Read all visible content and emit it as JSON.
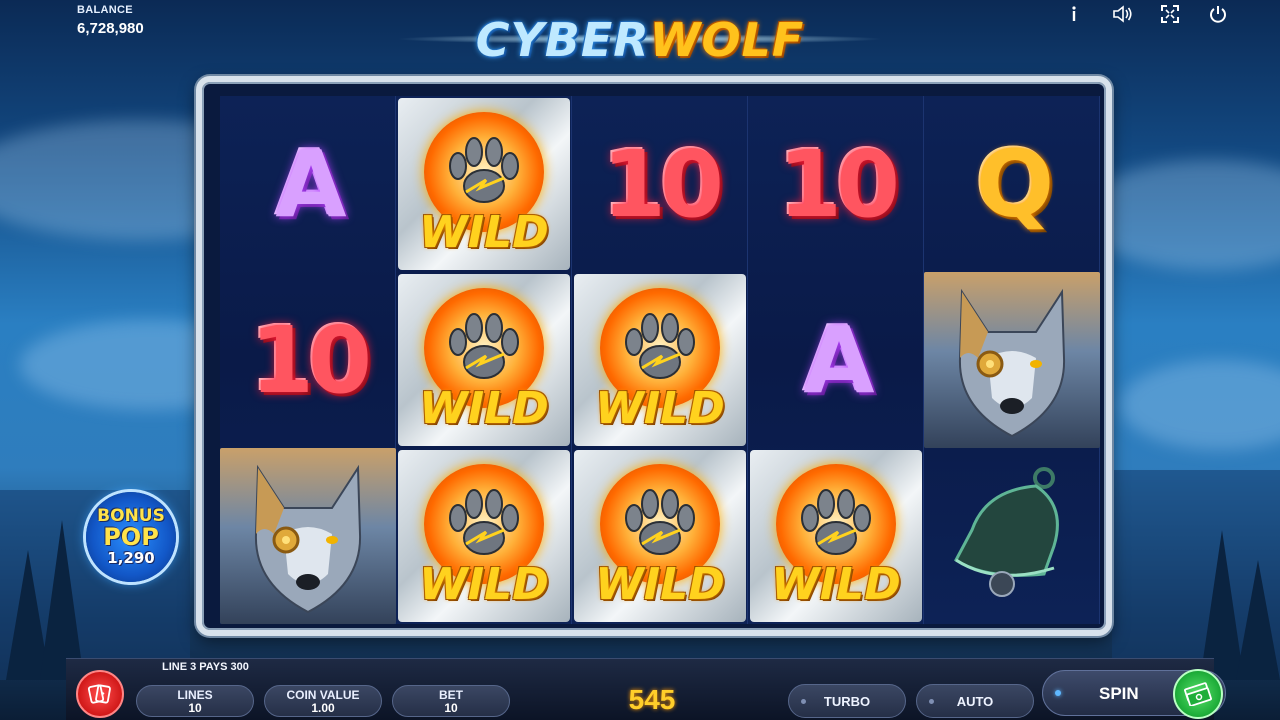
{
  "balance": {
    "label": "BALANCE",
    "value": "6,728,980"
  },
  "logo": {
    "part1": "CYBER",
    "part2": "WOLF"
  },
  "top_icons": [
    "info-icon",
    "sound-icon",
    "fullscreen-icon",
    "power-icon"
  ],
  "reels": {
    "grid": [
      [
        "A",
        "WILD",
        "10",
        "10",
        "Q"
      ],
      [
        "10",
        "WILD",
        "WILD",
        "A",
        "WOLF"
      ],
      [
        "WOLF",
        "WILD",
        "WILD",
        "WILD",
        "BELL"
      ]
    ],
    "wild_label": "WILD"
  },
  "bonus_pop": {
    "line1": "BONUS",
    "line2": "POP",
    "value": "1,290"
  },
  "footer": {
    "line_win": "LINE 3 PAYS 300",
    "lines": {
      "label": "LINES",
      "value": "10"
    },
    "coin_value": {
      "label": "COIN VALUE",
      "value": "1.00"
    },
    "bet": {
      "label": "BET",
      "value": "10"
    },
    "win": "545",
    "turbo": "TURBO",
    "auto": "AUTO",
    "spin": "SPIN"
  },
  "colors": {
    "wild_gold": "#ffd21e",
    "accent_blue": "#2a8fff",
    "spin_green": "#1fae3a",
    "paytable_red": "#d01818"
  }
}
